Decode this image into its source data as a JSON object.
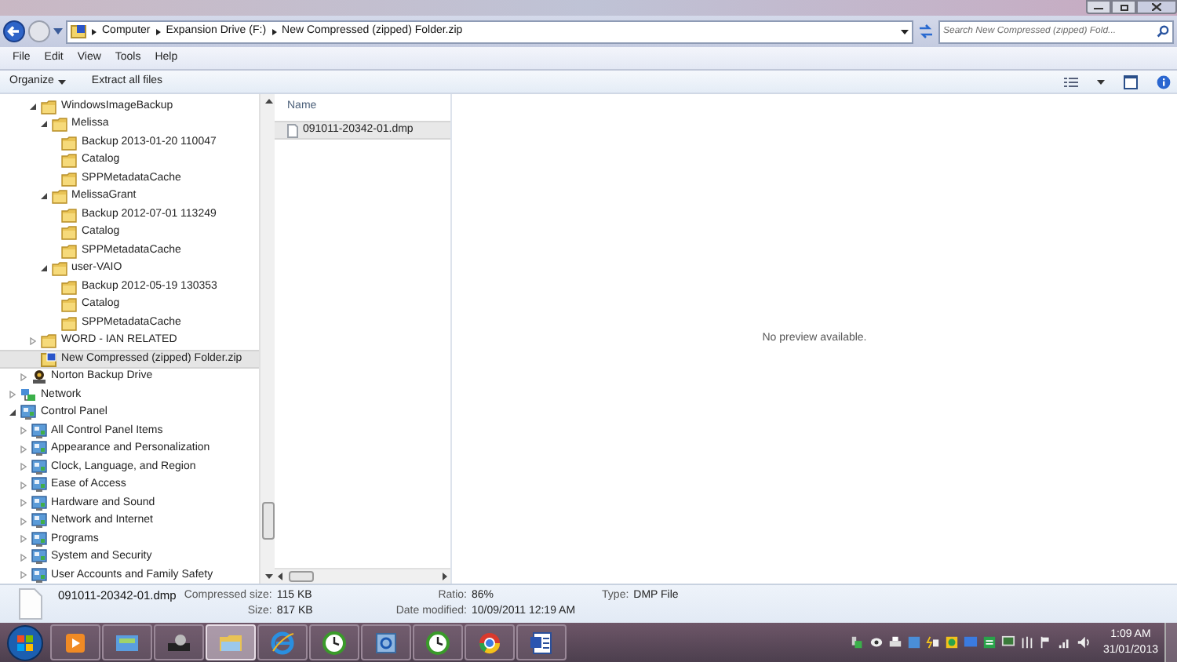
{
  "address_bar": {
    "segments": [
      "Computer",
      "Expansion Drive (F:)",
      "New Compressed (zipped) Folder.zip"
    ]
  },
  "search": {
    "placeholder": "Search New Compressed (zipped) Fold..."
  },
  "menu_bar": [
    "File",
    "Edit",
    "View",
    "Tools",
    "Help"
  ],
  "toolbar": {
    "organize": "Organize",
    "extract": "Extract all files"
  },
  "tree": {
    "partial_branch": [
      {
        "label": "WindowsImageBackup",
        "kind": "folder",
        "expanded": true,
        "selected": false,
        "children": [
          {
            "label": "Melissa",
            "kind": "folder",
            "expanded": true,
            "selected": false,
            "children": [
              {
                "label": "Backup 2013-01-20 110047",
                "kind": "folder",
                "selected": false
              },
              {
                "label": "Catalog",
                "kind": "folder",
                "selected": false
              },
              {
                "label": "SPPMetadataCache",
                "kind": "folder",
                "selected": false
              }
            ]
          },
          {
            "label": "MelissaGrant",
            "kind": "folder",
            "expanded": true,
            "selected": false,
            "children": [
              {
                "label": "Backup 2012-07-01 113249",
                "kind": "folder",
                "selected": false
              },
              {
                "label": "Catalog",
                "kind": "folder",
                "selected": false
              },
              {
                "label": "SPPMetadataCache",
                "kind": "folder",
                "selected": false
              }
            ]
          },
          {
            "label": "user-VAIO",
            "kind": "folder",
            "expanded": true,
            "selected": false,
            "children": [
              {
                "label": "Backup 2012-05-19 130353",
                "kind": "folder",
                "selected": false
              },
              {
                "label": "Catalog",
                "kind": "folder",
                "selected": false
              },
              {
                "label": "SPPMetadataCache",
                "kind": "folder",
                "selected": false
              }
            ]
          }
        ]
      },
      {
        "label": "WORD - IAN RELATED",
        "kind": "folder",
        "expanded": false,
        "selected": false
      },
      {
        "label": "New Compressed (zipped) Folder.zip",
        "kind": "zip",
        "selected": true
      }
    ],
    "drive_level": [
      {
        "label": "Norton Backup Drive",
        "kind": "drive",
        "expanded": false,
        "selected": false
      }
    ],
    "roots": [
      {
        "label": "Network",
        "kind": "network",
        "expanded": false,
        "selected": false
      },
      {
        "label": "Control Panel",
        "kind": "panel",
        "expanded": true,
        "selected": false,
        "children": [
          {
            "label": "All Control Panel Items",
            "kind": "panel",
            "expanded": false,
            "selected": false
          },
          {
            "label": "Appearance and Personalization",
            "kind": "panel",
            "expanded": false,
            "selected": false
          },
          {
            "label": "Clock, Language, and Region",
            "kind": "panel",
            "expanded": false,
            "selected": false
          },
          {
            "label": "Ease of Access",
            "kind": "panel",
            "expanded": false,
            "selected": false
          },
          {
            "label": "Hardware and Sound",
            "kind": "panel",
            "expanded": false,
            "selected": false
          },
          {
            "label": "Network and Internet",
            "kind": "panel",
            "expanded": false,
            "selected": false
          },
          {
            "label": "Programs",
            "kind": "panel",
            "expanded": false,
            "selected": false
          },
          {
            "label": "System and Security",
            "kind": "panel",
            "expanded": false,
            "selected": false
          },
          {
            "label": "User Accounts and Family Safety",
            "kind": "panel",
            "expanded": false,
            "selected": false
          }
        ]
      }
    ]
  },
  "file_list": {
    "columns": [
      "Name"
    ],
    "files": [
      {
        "name": "091011-20342-01.dmp",
        "selected": true
      }
    ]
  },
  "preview": {
    "message": "No preview available."
  },
  "details": {
    "name": "091011-20342-01.dmp",
    "fields": [
      {
        "label": "Compressed size:",
        "value": "115 KB"
      },
      {
        "label": "Size:",
        "value": "817 KB"
      },
      {
        "label": "Ratio:",
        "value": "86%"
      },
      {
        "label": "Date modified:",
        "value": "10/09/2011 12:19 AM"
      },
      {
        "label": "Type:",
        "value": "DMP File"
      }
    ]
  },
  "taskbar": {
    "apps": [
      {
        "kind": "media",
        "active": false
      },
      {
        "kind": "mail",
        "active": false
      },
      {
        "kind": "scanner",
        "active": false
      },
      {
        "kind": "explorer",
        "active": true
      },
      {
        "kind": "browser",
        "active": false
      },
      {
        "kind": "clock",
        "active": false
      },
      {
        "kind": "window",
        "active": false
      },
      {
        "kind": "clock",
        "active": false
      },
      {
        "kind": "chrome",
        "active": false
      },
      {
        "kind": "document",
        "active": false
      }
    ],
    "time": "1:09 AM",
    "date": "31/01/2013"
  }
}
